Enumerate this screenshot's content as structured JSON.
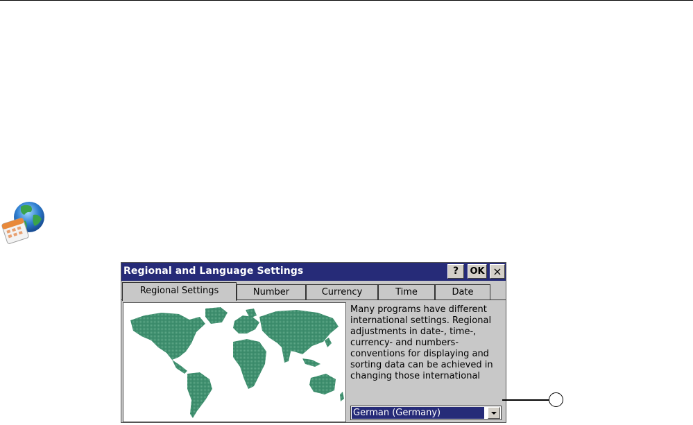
{
  "dialog": {
    "title": "Regional and Language Settings",
    "help_label": "?",
    "ok_label": "OK",
    "close_label": "×"
  },
  "tabs": [
    {
      "label": "Regional Settings",
      "active": true
    },
    {
      "label": "Number",
      "active": false
    },
    {
      "label": "Currency",
      "active": false
    },
    {
      "label": "Time",
      "active": false
    },
    {
      "label": "Date",
      "active": false
    }
  ],
  "description": "Many programs have different international settings. Regional adjustments in date-, time-, currency- and numbers-conventions for displaying and sorting data can be achieved in changing those international",
  "language_select": {
    "value": "German (Germany)"
  },
  "colors": {
    "titlebar": "#262b78",
    "map_land": "#3a8a6a",
    "dialog_bg": "#c8c8c8"
  },
  "icons": {
    "app": "globe-calendar-icon",
    "dropdown": "chevron-down-icon"
  }
}
